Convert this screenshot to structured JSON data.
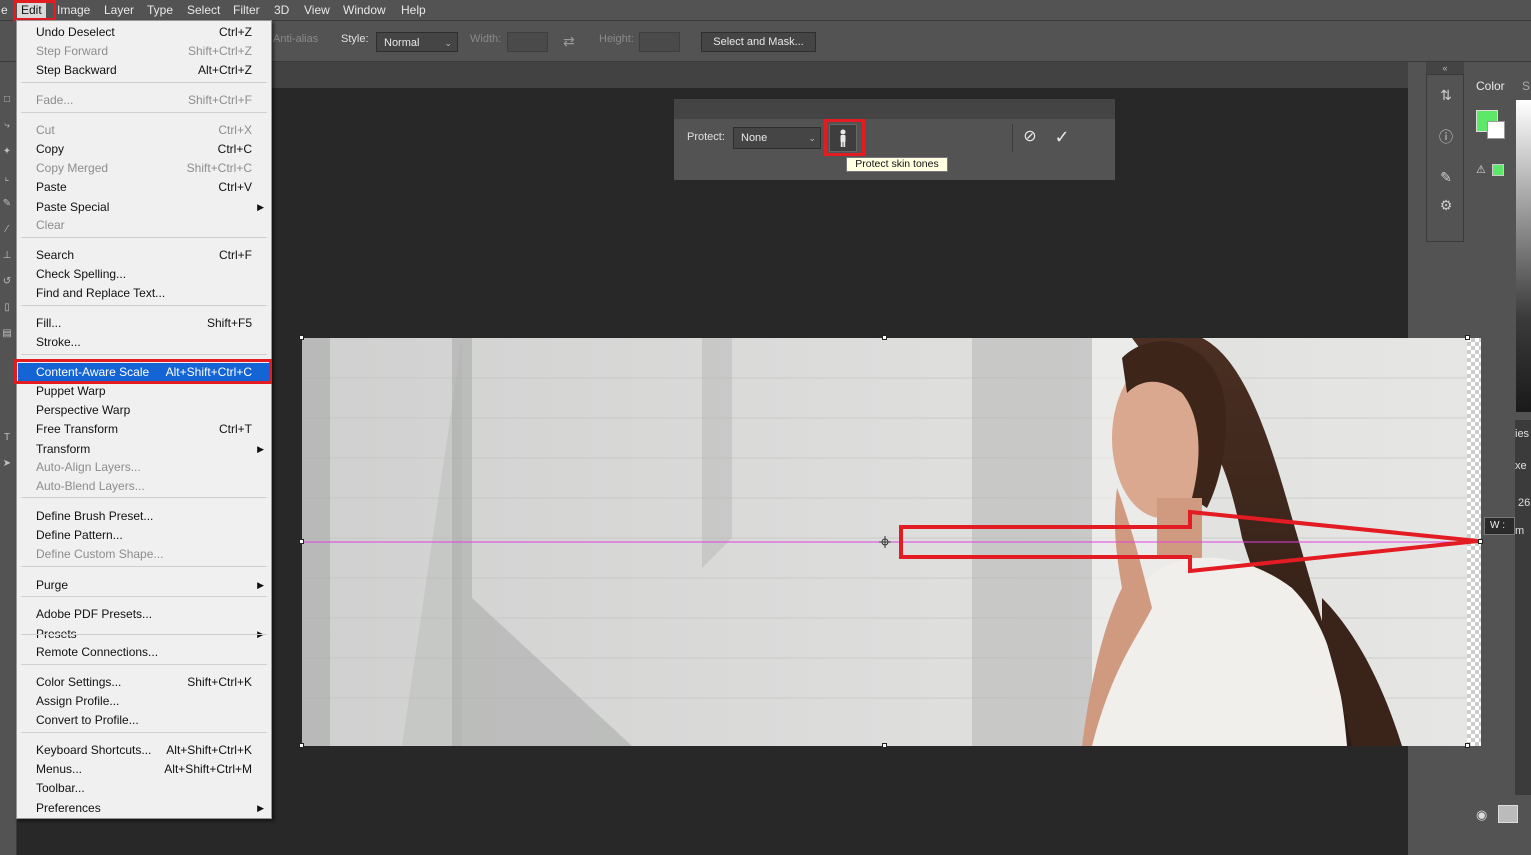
{
  "menubar": {
    "items": [
      "e",
      "Edit",
      "Image",
      "Layer",
      "Type",
      "Select",
      "Filter",
      "3D",
      "View",
      "Window",
      "Help"
    ]
  },
  "options": {
    "anti_alias": "Anti-alias",
    "style_label": "Style:",
    "style_value": "Normal",
    "width_label": "Width:",
    "height_label": "Height:",
    "select_mask": "Select and Mask..."
  },
  "ca_panel": {
    "protect_label": "Protect:",
    "protect_value": "None",
    "tooltip": "Protect skin tones"
  },
  "right_panel": {
    "color_tab": "Color",
    "next_tab": "S",
    "props_line1": "ies",
    "props_line2": "xe",
    "props_line3": "26",
    "props_line4": "m"
  },
  "transform": {
    "w_label": "W :"
  },
  "edit_menu": {
    "groups": [
      [
        {
          "label": "Undo Deselect",
          "shortcut": "Ctrl+Z",
          "disabled": false
        },
        {
          "label": "Step Forward",
          "shortcut": "Shift+Ctrl+Z",
          "disabled": true
        },
        {
          "label": "Step Backward",
          "shortcut": "Alt+Ctrl+Z",
          "disabled": false
        }
      ],
      [
        {
          "label": "Fade...",
          "shortcut": "Shift+Ctrl+F",
          "disabled": true
        }
      ],
      [
        {
          "label": "Cut",
          "shortcut": "Ctrl+X",
          "disabled": true
        },
        {
          "label": "Copy",
          "shortcut": "Ctrl+C",
          "disabled": false
        },
        {
          "label": "Copy Merged",
          "shortcut": "Shift+Ctrl+C",
          "disabled": true
        },
        {
          "label": "Paste",
          "shortcut": "Ctrl+V",
          "disabled": false
        },
        {
          "label": "Paste Special",
          "shortcut": "",
          "disabled": false,
          "submenu": true
        },
        {
          "label": "Clear",
          "shortcut": "",
          "disabled": true
        }
      ],
      [
        {
          "label": "Search",
          "shortcut": "Ctrl+F",
          "disabled": false
        },
        {
          "label": "Check Spelling...",
          "shortcut": "",
          "disabled": false
        },
        {
          "label": "Find and Replace Text...",
          "shortcut": "",
          "disabled": false
        }
      ],
      [
        {
          "label": "Fill...",
          "shortcut": "Shift+F5",
          "disabled": false
        },
        {
          "label": "Stroke...",
          "shortcut": "",
          "disabled": false
        }
      ],
      [
        {
          "label": "Content-Aware Scale",
          "shortcut": "Alt+Shift+Ctrl+C",
          "disabled": false,
          "highlighted": true
        },
        {
          "label": "Puppet Warp",
          "shortcut": "",
          "disabled": false
        },
        {
          "label": "Perspective Warp",
          "shortcut": "",
          "disabled": false
        },
        {
          "label": "Free Transform",
          "shortcut": "Ctrl+T",
          "disabled": false
        },
        {
          "label": "Transform",
          "shortcut": "",
          "disabled": false,
          "submenu": true
        },
        {
          "label": "Auto-Align Layers...",
          "shortcut": "",
          "disabled": true
        },
        {
          "label": "Auto-Blend Layers...",
          "shortcut": "",
          "disabled": true
        }
      ],
      [
        {
          "label": "Define Brush Preset...",
          "shortcut": "",
          "disabled": false
        },
        {
          "label": "Define Pattern...",
          "shortcut": "",
          "disabled": false
        },
        {
          "label": "Define Custom Shape...",
          "shortcut": "",
          "disabled": true
        }
      ],
      [
        {
          "label": "Purge",
          "shortcut": "",
          "disabled": false,
          "submenu": true
        }
      ],
      [
        {
          "label": "Adobe PDF Presets...",
          "shortcut": "",
          "disabled": false
        },
        {
          "label": "Presets",
          "shortcut": "",
          "disabled": false,
          "submenu": true
        },
        {
          "label": "Remote Connections...",
          "shortcut": "",
          "disabled": false
        }
      ],
      [
        {
          "label": "Color Settings...",
          "shortcut": "Shift+Ctrl+K",
          "disabled": false
        },
        {
          "label": "Assign Profile...",
          "shortcut": "",
          "disabled": false
        },
        {
          "label": "Convert to Profile...",
          "shortcut": "",
          "disabled": false
        }
      ],
      [
        {
          "label": "Keyboard Shortcuts...",
          "shortcut": "Alt+Shift+Ctrl+K",
          "disabled": false
        },
        {
          "label": "Menus...",
          "shortcut": "Alt+Shift+Ctrl+M",
          "disabled": false
        },
        {
          "label": "Toolbar...",
          "shortcut": "",
          "disabled": false
        },
        {
          "label": "Preferences",
          "shortcut": "",
          "disabled": false,
          "submenu": true
        }
      ]
    ]
  },
  "colors": {
    "foreground": "#5de86a",
    "background": "#ffffff",
    "highlight_red": "#e31b23",
    "menu_selection": "#1564d6",
    "guide_line": "#e040e0"
  }
}
